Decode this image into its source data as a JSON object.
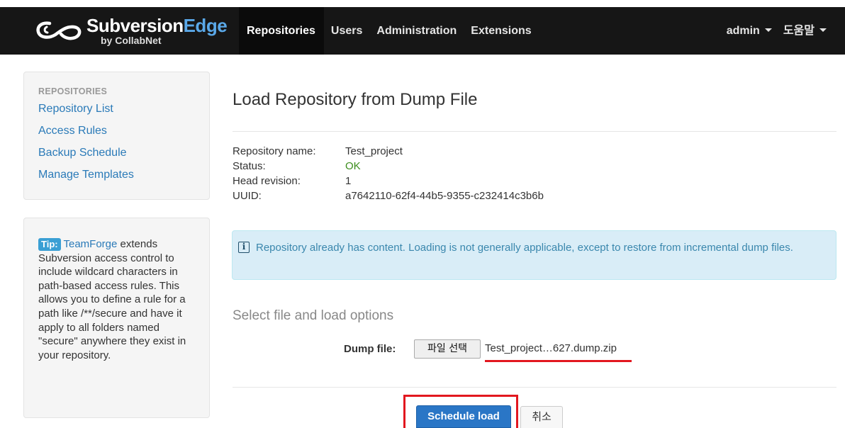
{
  "navbar": {
    "brand_name_part1": "Subversion",
    "brand_name_part2": "Edge",
    "brand_sub": "by CollabNet",
    "items": [
      {
        "label": "Repositories",
        "active": true
      },
      {
        "label": "Users"
      },
      {
        "label": "Administration"
      },
      {
        "label": "Extensions"
      }
    ],
    "user_menu": "admin",
    "help_menu": "도움말"
  },
  "sidebar": {
    "heading": "REPOSITORIES",
    "links": [
      "Repository List",
      "Access Rules",
      "Backup Schedule",
      "Manage Templates"
    ]
  },
  "tip": {
    "label": "Tip:",
    "link": "TeamForge",
    "text": " extends Subversion access control to include wildcard characters in path-based access rules. This allows you to define a rule for a path like /**/secure and have it apply to all folders named \"secure\" anywhere they exist in your repository."
  },
  "main": {
    "title": "Load Repository from Dump File",
    "info": [
      {
        "key": "Repository name:",
        "value": "Test_project"
      },
      {
        "key": "Status:",
        "value": "OK"
      },
      {
        "key": "Head revision:",
        "value": "1"
      },
      {
        "key": "UUID:",
        "value": "a7642110-62f4-44b5-9355-c232414c3b6b"
      }
    ],
    "alert": "Repository already has content. Loading is not generally applicable, except to restore from incremental dump files.",
    "section_title": "Select file and load options",
    "dump_label": "Dump file:",
    "file_button": "파일 선택",
    "file_name": "Test_project…627.dump.zip",
    "schedule_button": "Schedule load",
    "cancel_button": "취소"
  },
  "colors": {
    "navbar_bg": "#161616",
    "link": "#2a7ab8",
    "primary": "#2a76c6",
    "status_ok": "#3c8d1c",
    "alert_bg": "#d9edf7",
    "highlight": "#e2171f"
  },
  "icons": {
    "brand": "collabnet-swirl-logo",
    "alert": "info-icon",
    "dropdown": "caret-down-icon"
  }
}
